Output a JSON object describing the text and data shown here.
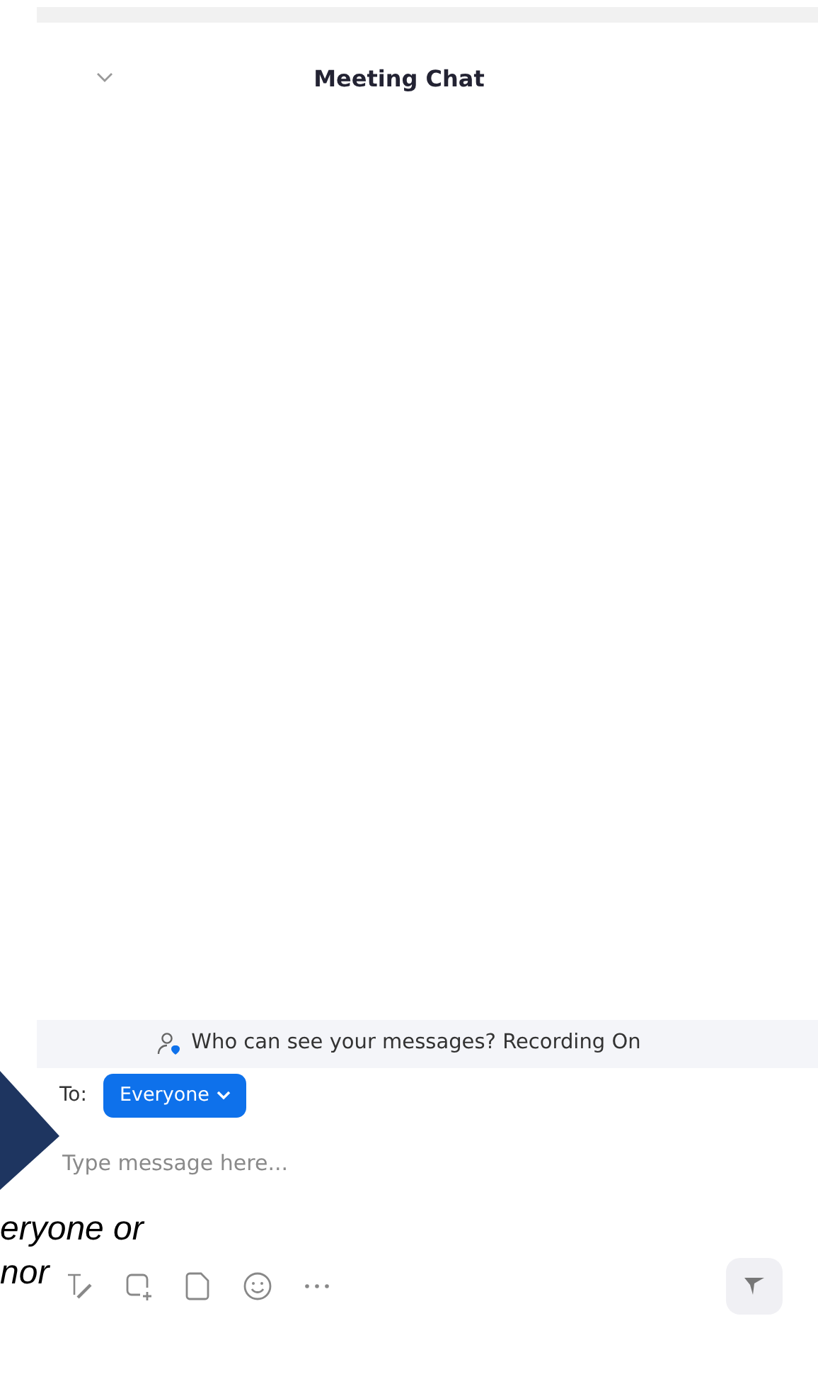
{
  "header": {
    "title": "Meeting Chat"
  },
  "notice": {
    "text": "Who can see your messages? Recording On"
  },
  "recipient": {
    "label": "To:",
    "value": "Everyone"
  },
  "message_field": {
    "placeholder": "Type message here..."
  },
  "send_button": {
    "disabled": true
  },
  "callout": {
    "lines": [
      "eryone or",
      "nor"
    ]
  }
}
